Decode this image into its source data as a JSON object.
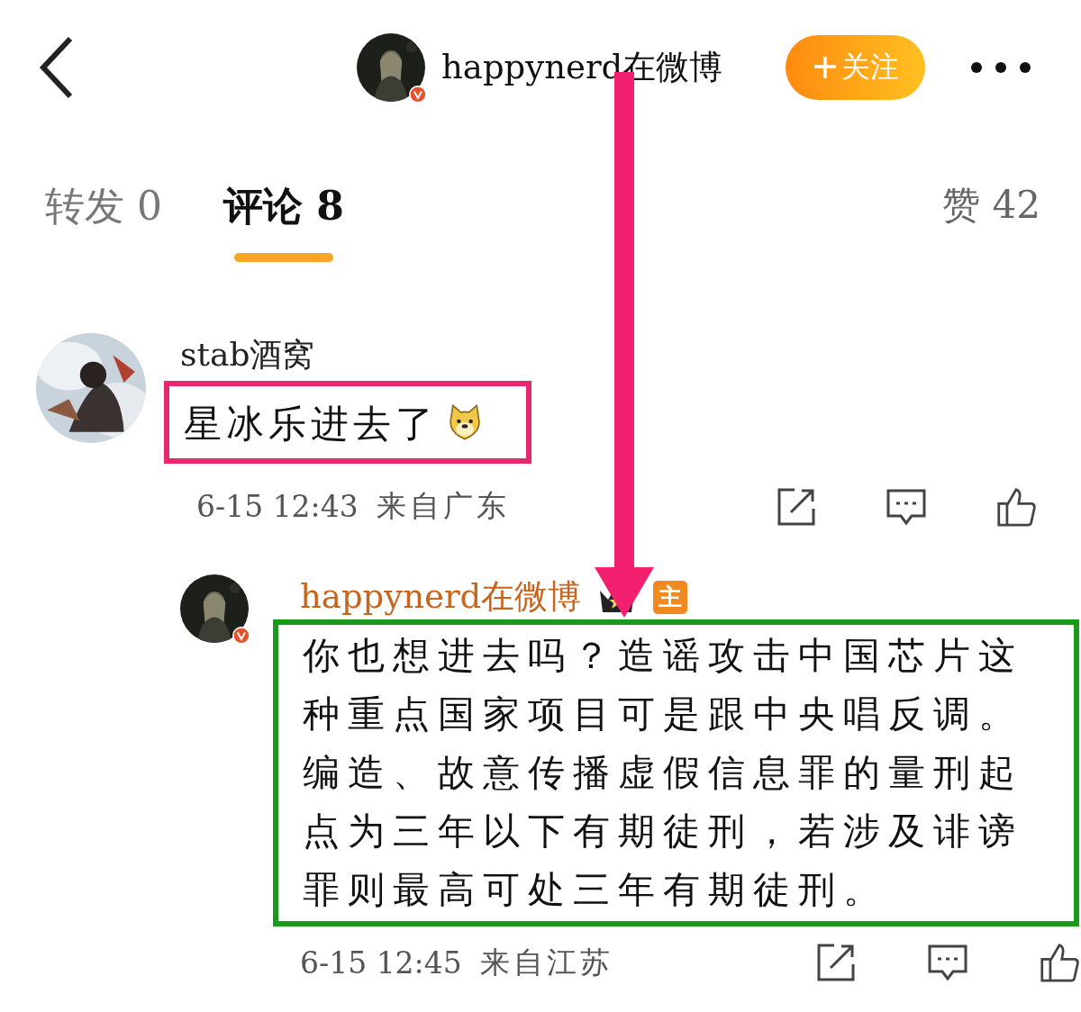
{
  "header": {
    "title": "happynerd在微博",
    "follow_button": "关注"
  },
  "tabs": [
    {
      "label": "转发 0",
      "selected": false
    },
    {
      "label": "评论 8",
      "selected": true
    }
  ],
  "likes": "赞 42",
  "comments": [
    {
      "kind": "comment",
      "user": "stab酒窝",
      "text": "星冰乐进去了",
      "time": "6-15 12:43",
      "location": "来自广东",
      "color": "#e8286e"
    },
    {
      "kind": "reply",
      "user": "happynerd在微博",
      "badge": "主",
      "text": "你也想进去吗？造谣攻击中国芯片这种重点国家项目可是跟中央唱反调。编造、故意传播虚假信息罪的量刑起点为三年以下有期徒刑，若涉及诽谤罪则最高可处三年有期徒刑。",
      "time": "6-15 12:45",
      "location": "来自江苏",
      "color": "#1a9a1a"
    }
  ]
}
